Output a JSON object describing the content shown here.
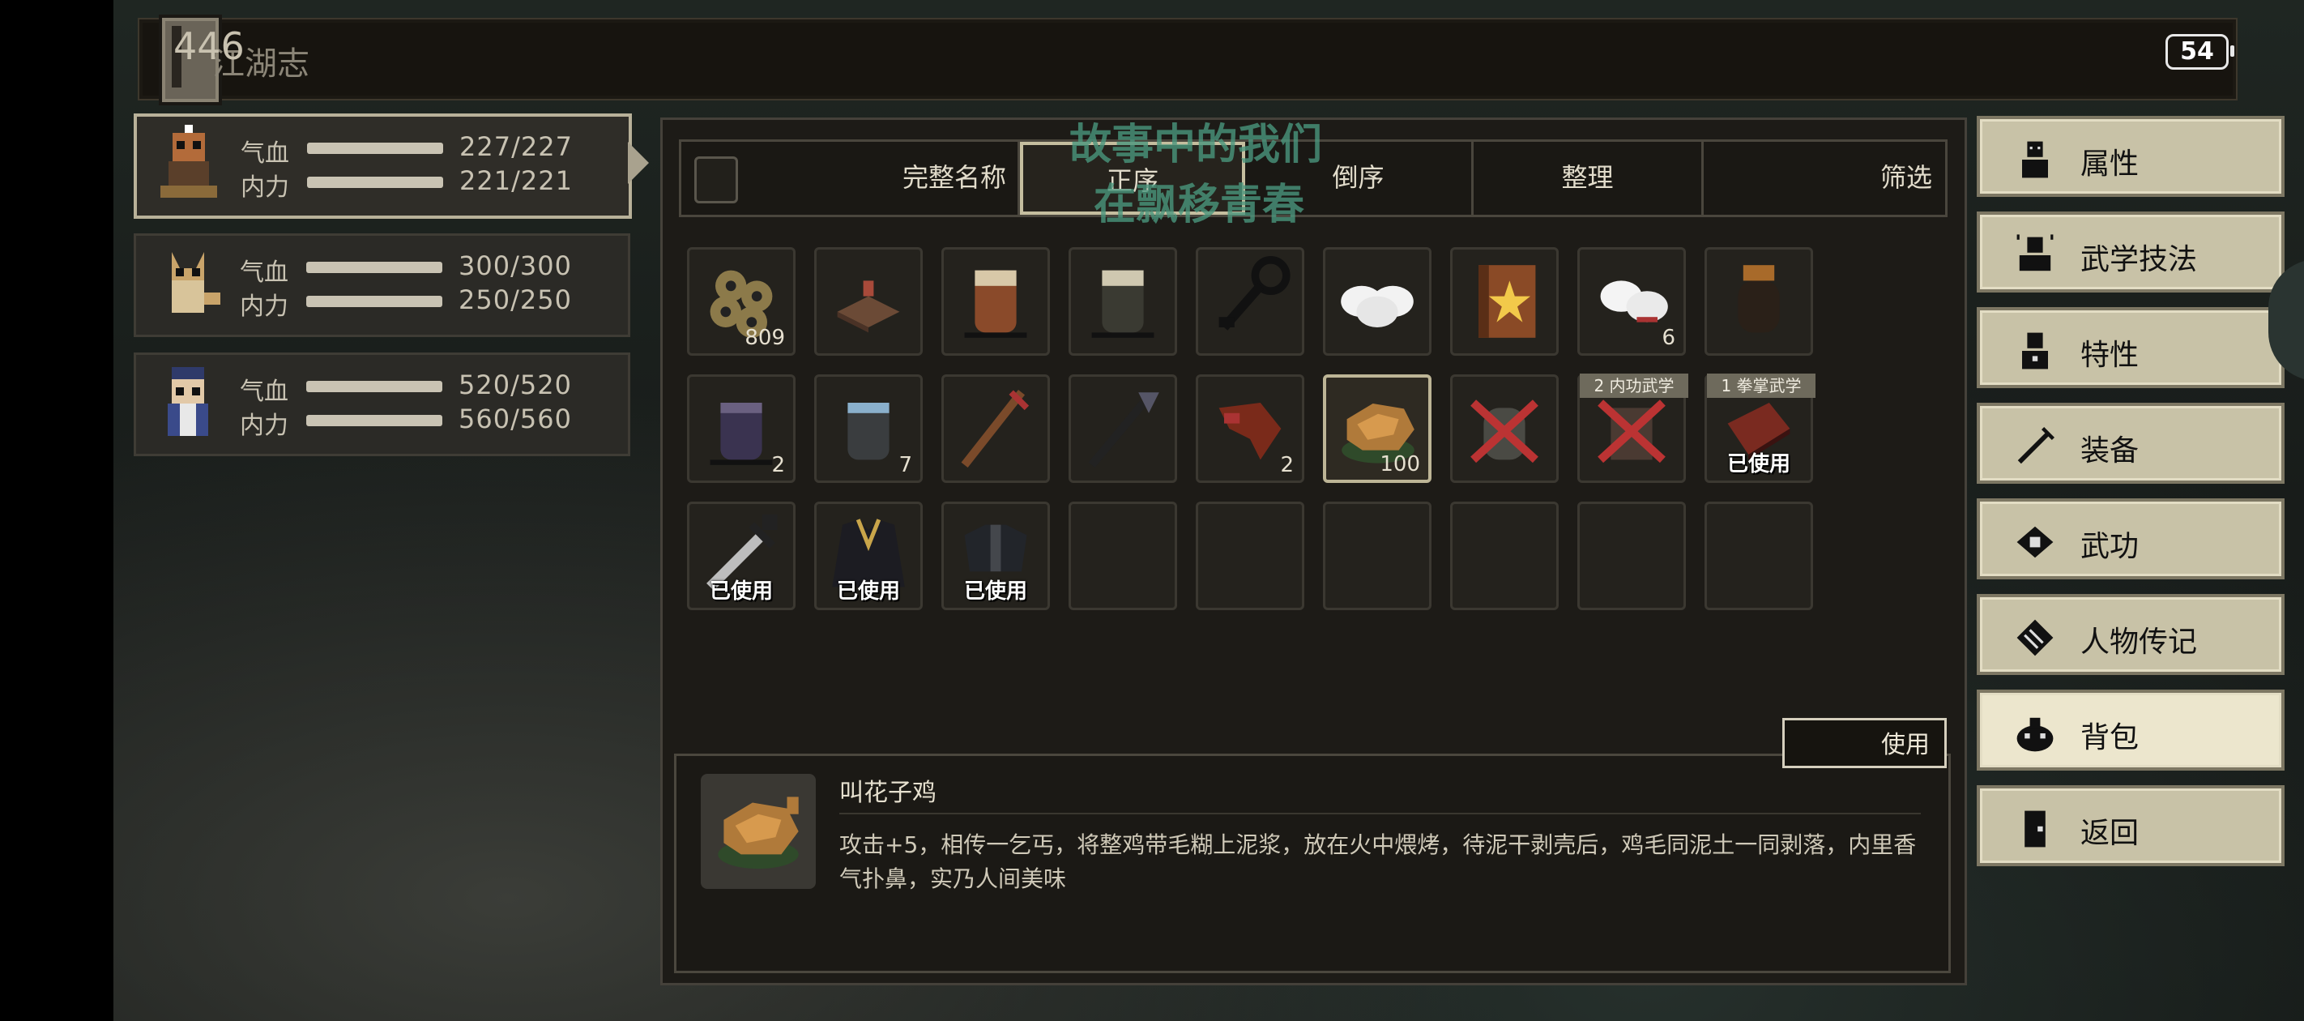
{
  "top_bar": {
    "title": "江湖志",
    "score": "446",
    "battery": "54"
  },
  "party": [
    {
      "hp_label": "气血",
      "hp": "227/227",
      "mp_label": "内力",
      "mp": "221/221",
      "hp_frac": 1.0,
      "mp_frac": 1.0
    },
    {
      "hp_label": "气血",
      "hp": "300/300",
      "mp_label": "内力",
      "mp": "250/250",
      "hp_frac": 1.0,
      "mp_frac": 1.0
    },
    {
      "hp_label": "气血",
      "hp": "520/520",
      "mp_label": "内力",
      "mp": "560/560",
      "hp_frac": 1.0,
      "mp_frac": 1.0
    }
  ],
  "tabs": {
    "full_name": "完整名称",
    "asc": "正序",
    "desc": "倒序",
    "sort": "整理",
    "filter": "筛选"
  },
  "inventory": [
    {
      "icon": "coins-icon",
      "count": "809"
    },
    {
      "icon": "cake-icon"
    },
    {
      "icon": "wine-jar-icon"
    },
    {
      "icon": "tea-jar-icon"
    },
    {
      "icon": "key-icon"
    },
    {
      "icon": "rice-balls-icon"
    },
    {
      "icon": "manual-star-icon"
    },
    {
      "icon": "steamed-buns-icon",
      "count": "6"
    },
    {
      "icon": "pot-icon"
    },
    {
      "icon": "purple-jar-icon",
      "count": "2"
    },
    {
      "icon": "water-jar-icon",
      "count": "7"
    },
    {
      "icon": "staff-icon"
    },
    {
      "icon": "spear-icon"
    },
    {
      "icon": "chicken-leg-icon",
      "count": "2"
    },
    {
      "icon": "roast-chicken-icon",
      "count": "100",
      "selected": true
    },
    {
      "icon": "sealed-jar-icon"
    },
    {
      "icon": "martial-art-icon",
      "tag": "2 内功武学"
    },
    {
      "icon": "palm-book-icon",
      "tag": "1 拳掌武学",
      "used": "已使用"
    },
    {
      "icon": "sword-icon",
      "used": "已使用"
    },
    {
      "icon": "robe-icon",
      "used": "已使用"
    },
    {
      "icon": "vest-icon",
      "used": "已使用"
    }
  ],
  "detail": {
    "name": "叫花子鸡",
    "description": "攻击+5，相传一乞丐，将整鸡带毛糊上泥浆，放在火中煨烤，待泥干剥壳后，鸡毛同泥土一同剥落，内里香气扑鼻，实乃人间美味",
    "use_label": "使用"
  },
  "menu": [
    {
      "label": "属性",
      "icon": "person-icon"
    },
    {
      "label": "武学技法",
      "icon": "meditation-icon"
    },
    {
      "label": "特性",
      "icon": "trait-person-icon"
    },
    {
      "label": "装备",
      "icon": "sword-icon"
    },
    {
      "label": "武功",
      "icon": "manual-icon"
    },
    {
      "label": "人物传记",
      "icon": "scroll-icon"
    },
    {
      "label": "背包",
      "icon": "bag-icon",
      "active": true
    },
    {
      "label": "返回",
      "icon": "door-icon"
    }
  ],
  "watermark": {
    "line1": "故事中的我们",
    "line2": "在飘移青春"
  },
  "colors": {
    "panel_bg": "#1d1b17",
    "border": "#4a463d",
    "menu_bg": "#c8c2a7",
    "text": "#e2dccb"
  }
}
